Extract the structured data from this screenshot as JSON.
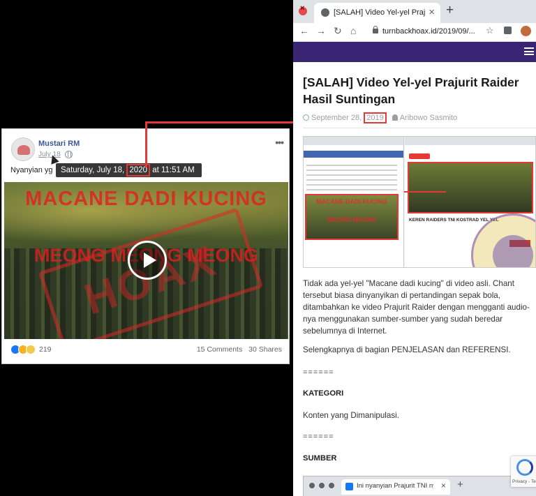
{
  "facebook_post": {
    "author": "Mustari RM",
    "date": "July 18",
    "text": "Nyanyian yg",
    "tooltip_prefix": "Saturday, July 18, ",
    "tooltip_year": "2020",
    "tooltip_suffix": " at 11:51 AM",
    "video_title_1": "MACANE DADI KUCING",
    "video_title_2": "MEONG MEONG MEONG",
    "stamp_text": "HOAX",
    "reaction_count": "219",
    "comments": "15 Comments",
    "shares": "30 Shares",
    "more_label": "•••"
  },
  "browser": {
    "tab_title": "[SALAH] Video Yel-yel Praj",
    "tab_close": "×",
    "new_tab": "+",
    "back": "←",
    "forward": "→",
    "reload": "↻",
    "home": "⌂",
    "url": "turnbackhoax.id/2019/09/...",
    "star": "☆"
  },
  "article": {
    "title": "[SALAH] Video Yel-yel Prajurit Raider Hasil Suntingan",
    "date_prefix": "September 28, ",
    "date_year": "2019",
    "author": "Aribowo Sasmito",
    "paragraph1": "Tidak ada yel-yel \"Macane dadi kucing\" di video asli. Chant tersebut biasa dinyanyikan di pertandingan sepak bola, ditambahkan ke video Prajurit Raider dengan mengganti audio-nya menggunakan sumber-sumber yang sudah beredar sebelumnya di Internet.",
    "paragraph2": "Selengkapnya di bagian PENJELASAN dan REFERENSI.",
    "separator1": "======",
    "heading_kategori": "KATEGORI",
    "kategori_value": "Konten yang Dimanipulasi.",
    "separator2": "======",
    "heading_sumber": "SUMBER"
  },
  "embedded_screenshot": {
    "left_overlay_1": "MACANE DADI KUCING",
    "left_overlay_2": "MEONG MEONG",
    "right_video_title": "KEREN RAIDERS TNI KOSTRAD YEL YEL"
  },
  "recaptcha": {
    "label": "Privacy - Te"
  },
  "embed_browser": {
    "tab_title": "Ini nyanyian Prajurit TNI nyindir",
    "close": "×",
    "plus": "+"
  },
  "colors": {
    "highlight_red": "#e53935",
    "site_purple": "#3a2474",
    "fb_name_blue": "#385898"
  }
}
